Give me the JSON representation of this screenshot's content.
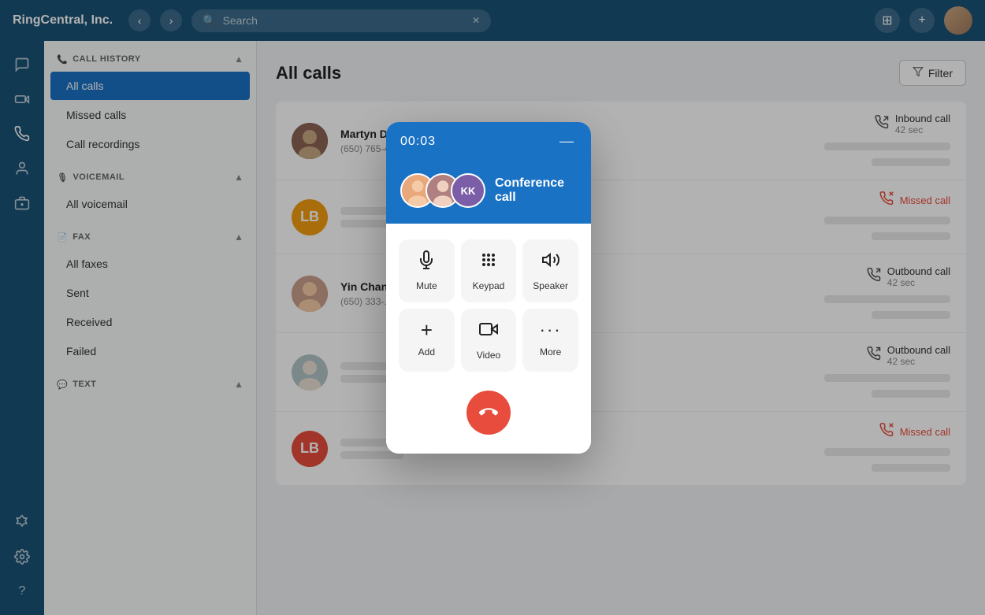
{
  "app": {
    "title": "RingCentral, Inc.",
    "search_placeholder": "Search"
  },
  "topbar": {
    "back_label": "‹",
    "forward_label": "›",
    "grid_icon": "⊞",
    "add_icon": "+"
  },
  "sidebar": {
    "call_history_label": "CALL HISTORY",
    "items_call": [
      {
        "label": "All calls",
        "active": true
      },
      {
        "label": "Missed calls",
        "active": false
      },
      {
        "label": "Call recordings",
        "active": false
      }
    ],
    "voicemail_label": "VOICEMAIL",
    "items_voicemail": [
      {
        "label": "All voicemail",
        "active": false
      }
    ],
    "fax_label": "FAX",
    "items_fax": [
      {
        "label": "All faxes",
        "active": false
      },
      {
        "label": "Sent",
        "active": false
      },
      {
        "label": "Received",
        "active": false
      },
      {
        "label": "Failed",
        "active": false
      }
    ],
    "text_label": "TEXT"
  },
  "content": {
    "title": "All calls",
    "filter_label": "Filter"
  },
  "calls": [
    {
      "id": 1,
      "name": "Martyn Daniele",
      "number": "(650) 765-4...",
      "type": "Inbound call",
      "duration": "42 sec",
      "missed": false,
      "avatar_type": "photo",
      "avatar_initials": ""
    },
    {
      "id": 2,
      "name": "",
      "number": "",
      "type": "Missed call",
      "duration": "",
      "missed": true,
      "avatar_type": "initials",
      "avatar_initials": "LB",
      "avatar_color": "orange"
    },
    {
      "id": 3,
      "name": "Yin Chan...",
      "number": "(650) 333-...",
      "type": "Outbound call",
      "duration": "42 sec",
      "missed": false,
      "avatar_type": "photo",
      "avatar_initials": ""
    },
    {
      "id": 4,
      "name": "",
      "number": "",
      "type": "Outbound call",
      "duration": "42 sec",
      "missed": false,
      "avatar_type": "photo",
      "avatar_initials": ""
    },
    {
      "id": 5,
      "name": "",
      "number": "",
      "type": "Missed call",
      "duration": "",
      "missed": true,
      "avatar_type": "initials",
      "avatar_initials": "LB",
      "avatar_color": "red"
    }
  ],
  "call_modal": {
    "timer": "00:03",
    "minimize_icon": "—",
    "conference_label": "Conference call",
    "participant1_initials": "",
    "participant2_initials": "KK",
    "controls": [
      {
        "icon": "🎤",
        "label": "Mute"
      },
      {
        "icon": "⠿",
        "label": "Keypad"
      },
      {
        "icon": "🔊",
        "label": "Speaker"
      },
      {
        "icon": "+",
        "label": "Add"
      },
      {
        "icon": "🎬",
        "label": "Video"
      },
      {
        "icon": "···",
        "label": "More"
      }
    ],
    "end_call_icon": "📞"
  },
  "rail_icons": [
    {
      "name": "chat-icon",
      "symbol": "💬"
    },
    {
      "name": "video-icon",
      "symbol": "📹"
    },
    {
      "name": "phone-icon",
      "symbol": "📞"
    },
    {
      "name": "contacts-icon",
      "symbol": "👤"
    },
    {
      "name": "fax-icon",
      "symbol": "🖨"
    }
  ],
  "rail_bottom_icons": [
    {
      "name": "puzzle-icon",
      "symbol": "🧩"
    },
    {
      "name": "settings-icon",
      "symbol": "⚙"
    },
    {
      "name": "help-icon",
      "symbol": "?"
    }
  ]
}
